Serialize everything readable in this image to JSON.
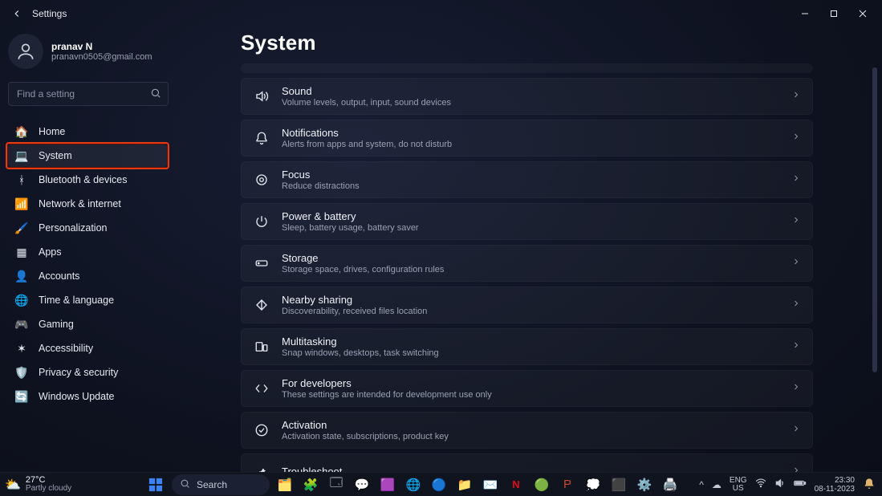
{
  "titlebar": {
    "title": "Settings"
  },
  "user": {
    "name": "pranav N",
    "email": "pranavn0505@gmail.com"
  },
  "search": {
    "placeholder": "Find a setting"
  },
  "nav": {
    "items": [
      {
        "key": "home",
        "label": "Home",
        "icon": "🏠"
      },
      {
        "key": "system",
        "label": "System",
        "icon": "💻"
      },
      {
        "key": "bluetooth",
        "label": "Bluetooth & devices",
        "icon": "ᚼ"
      },
      {
        "key": "network",
        "label": "Network & internet",
        "icon": "📶"
      },
      {
        "key": "personal",
        "label": "Personalization",
        "icon": "🖌️"
      },
      {
        "key": "apps",
        "label": "Apps",
        "icon": "▦"
      },
      {
        "key": "accounts",
        "label": "Accounts",
        "icon": "👤"
      },
      {
        "key": "time",
        "label": "Time & language",
        "icon": "🌐"
      },
      {
        "key": "gaming",
        "label": "Gaming",
        "icon": "🎮"
      },
      {
        "key": "accessibility",
        "label": "Accessibility",
        "icon": "✶"
      },
      {
        "key": "privacy",
        "label": "Privacy & security",
        "icon": "🛡️"
      },
      {
        "key": "update",
        "label": "Windows Update",
        "icon": "🔄"
      }
    ],
    "selected": "system",
    "highlighted": "system"
  },
  "page": {
    "title": "System"
  },
  "cards": [
    {
      "key": "sound",
      "title": "Sound",
      "sub": "Volume levels, output, input, sound devices"
    },
    {
      "key": "notifications",
      "title": "Notifications",
      "sub": "Alerts from apps and system, do not disturb"
    },
    {
      "key": "focus",
      "title": "Focus",
      "sub": "Reduce distractions"
    },
    {
      "key": "power",
      "title": "Power & battery",
      "sub": "Sleep, battery usage, battery saver"
    },
    {
      "key": "storage",
      "title": "Storage",
      "sub": "Storage space, drives, configuration rules"
    },
    {
      "key": "nearby",
      "title": "Nearby sharing",
      "sub": "Discoverability, received files location"
    },
    {
      "key": "multitask",
      "title": "Multitasking",
      "sub": "Snap windows, desktops, task switching"
    },
    {
      "key": "developers",
      "title": "For developers",
      "sub": "These settings are intended for development use only"
    },
    {
      "key": "activation",
      "title": "Activation",
      "sub": "Activation state, subscriptions, product key"
    },
    {
      "key": "troubleshoot",
      "title": "Troubleshoot",
      "sub": ""
    }
  ],
  "taskbar": {
    "weather": {
      "temp": "27°C",
      "desc": "Partly cloudy"
    },
    "search_label": "Search",
    "lang": {
      "top": "ENG",
      "bottom": "US"
    },
    "clock": {
      "time": "23:30",
      "date": "08-11-2023"
    }
  }
}
